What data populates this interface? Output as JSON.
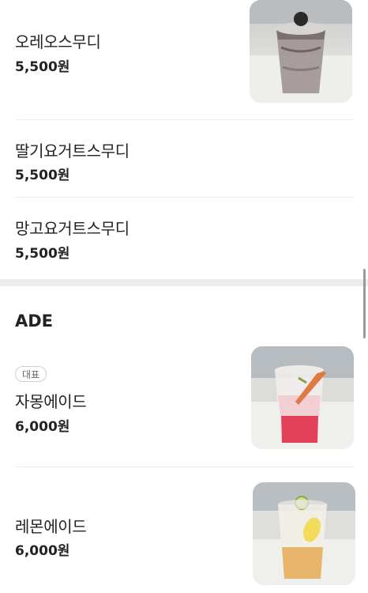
{
  "menu": {
    "items_top": [
      {
        "name": "오레오스무디",
        "price": "5,500원"
      },
      {
        "name": "딸기요거트스무디",
        "price": "5,500원"
      },
      {
        "name": "망고요거트스무디",
        "price": "5,500원"
      }
    ],
    "ade_section": {
      "title": "ADE",
      "items": [
        {
          "badge": "대표",
          "name": "자몽에이드",
          "price": "6,000원"
        },
        {
          "name": "레몬에이드",
          "price": "6,000원"
        }
      ]
    }
  },
  "icons": [
    "oreo-smoothie-photo",
    "grapefruit-ade-photo",
    "lemon-ade-photo"
  ],
  "colors": {
    "section_gap": "#ececec",
    "divider": "#eeeeee",
    "text": "#222222"
  }
}
